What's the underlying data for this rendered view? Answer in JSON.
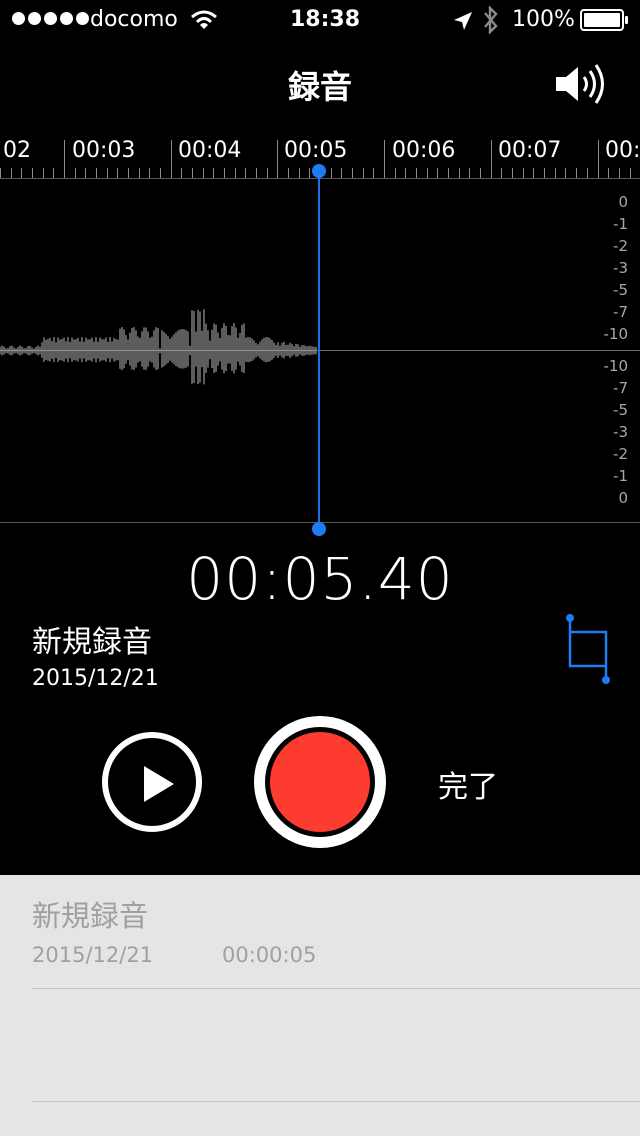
{
  "status_bar": {
    "carrier": "docomo",
    "time": "18:38",
    "battery": "100%",
    "icons": [
      "signal-dots-icon",
      "wifi-icon",
      "location-arrow-icon",
      "bluetooth-icon",
      "battery-icon"
    ]
  },
  "nav": {
    "title": "録音",
    "speaker_icon": "speaker-icon"
  },
  "ruler": {
    "labels": [
      "02",
      "00:03",
      "00:04",
      "00:05",
      "00:06",
      "00:07",
      "00:"
    ]
  },
  "waveform": {
    "db_top": [
      "0",
      "-1",
      "-2",
      "-3",
      "-5",
      "-7",
      "-10"
    ],
    "db_bottom": [
      "-10",
      "-7",
      "-5",
      "-3",
      "-2",
      "-1",
      "0"
    ],
    "playhead_color": "#1e7cf2"
  },
  "recording": {
    "timer": "00:05.40",
    "name": "新規録音",
    "date": "2015/12/21",
    "crop_icon": "trim-icon"
  },
  "controls": {
    "play_icon": "play-icon",
    "record_color": "#fd3b2f",
    "done_label": "完了"
  },
  "list": {
    "items": [
      {
        "title": "新規録音",
        "date": "2015/12/21",
        "duration": "00:00:05"
      }
    ]
  }
}
